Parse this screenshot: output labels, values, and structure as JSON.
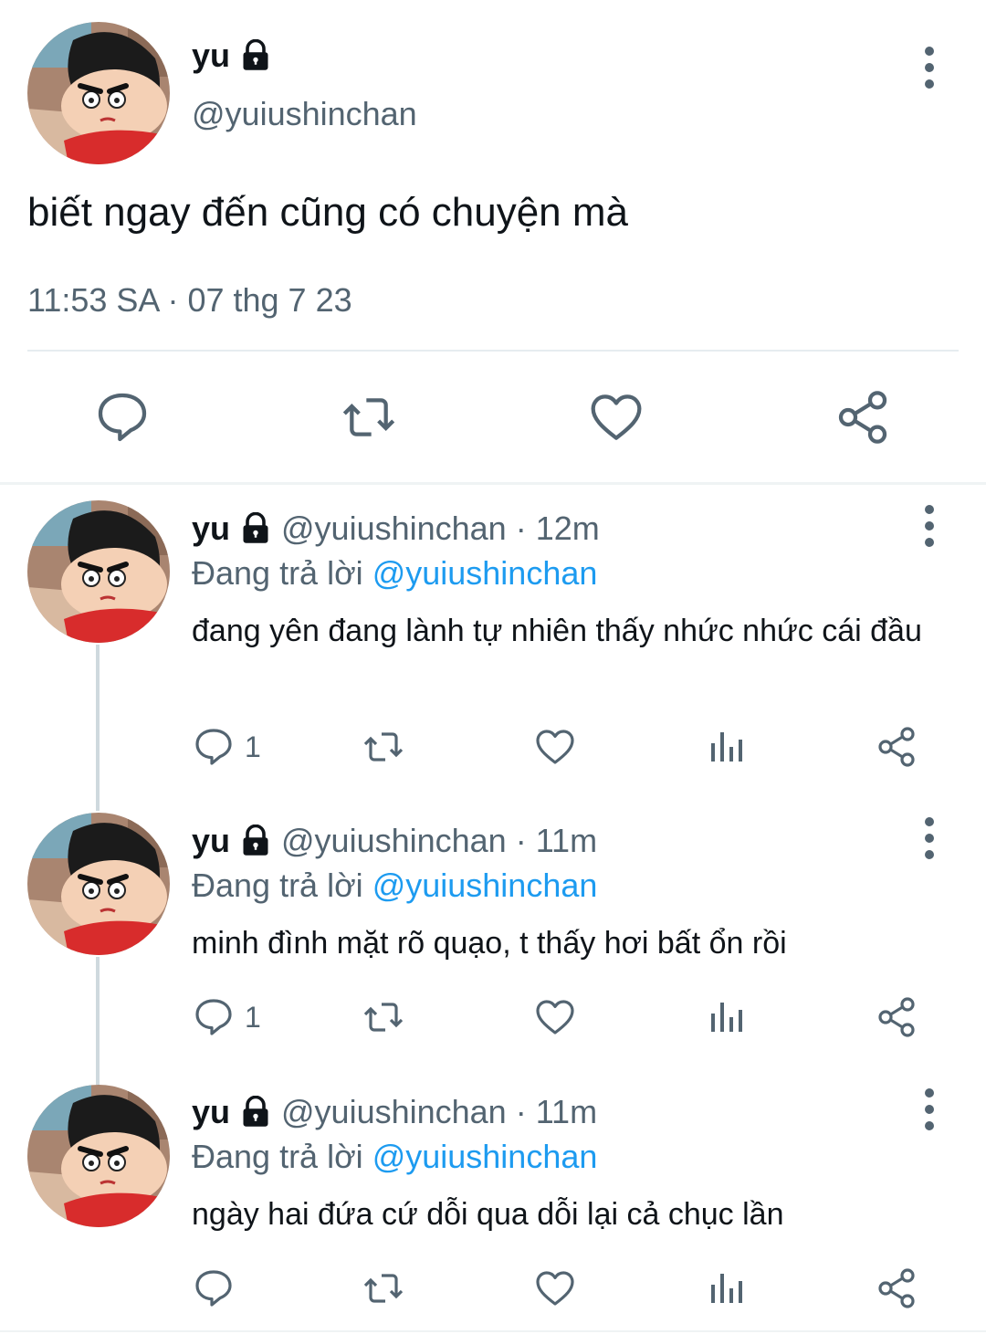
{
  "main_tweet": {
    "display_name": "yu",
    "handle": "@yuiushinchan",
    "text": "biết ngay đến cũng có chuyện mà",
    "meta": "11:53 SA · 07 thg 7 23",
    "icons": [
      "lock-icon",
      "more-vertical-icon",
      "reply-icon",
      "retweet-icon",
      "like-icon",
      "share-icon"
    ]
  },
  "replies": [
    {
      "display_name": "yu",
      "handle": "@yuiushinchan",
      "time": "· 12m",
      "replying_prefix": "Đang trả lời",
      "replying_to": "@yuiushinchan",
      "text": "đang yên đang lành tự nhiên thấy nhức nhức cái đầu",
      "reply_count": "1"
    },
    {
      "display_name": "yu",
      "handle": "@yuiushinchan",
      "time": "· 11m",
      "replying_prefix": "Đang trả lời",
      "replying_to": "@yuiushinchan",
      "text": "minh đình mặt rõ quạo, t thấy hơi bất ổn rồi",
      "reply_count": "1"
    },
    {
      "display_name": "yu",
      "handle": "@yuiushinchan",
      "time": "· 11m",
      "replying_prefix": "Đang trả lời",
      "replying_to": "@yuiushinchan",
      "text": "ngày hai đứa cứ dỗi qua dỗi lại cả chục lần",
      "reply_count": ""
    }
  ],
  "colors": {
    "text": "#0f1419",
    "muted": "#536471",
    "link": "#1d9bf0",
    "divider": "#eff3f4"
  }
}
